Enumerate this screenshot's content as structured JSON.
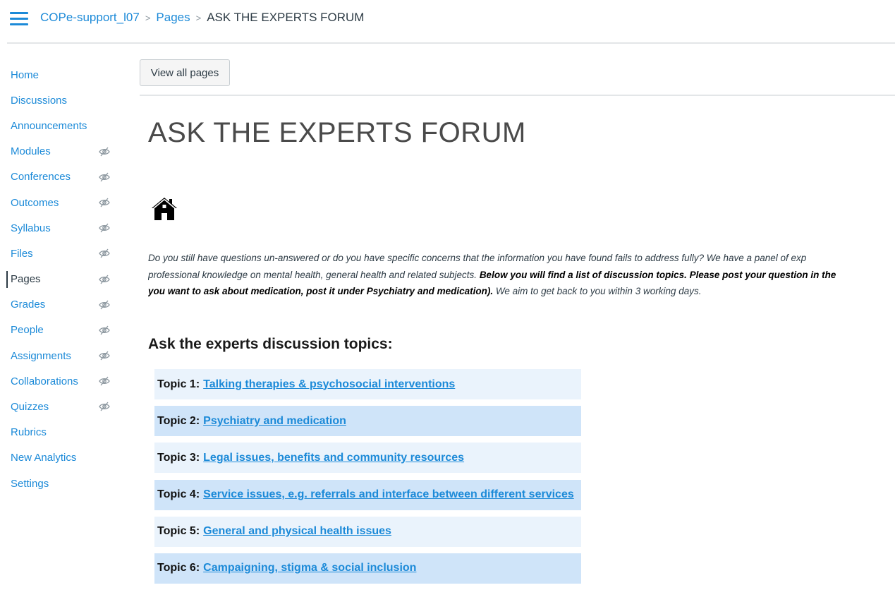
{
  "header": {
    "breadcrumb": {
      "course": "COPe-support_l07",
      "section": "Pages",
      "current": "ASK THE EXPERTS FORUM",
      "separator": ">"
    }
  },
  "sidebar": {
    "items": [
      {
        "label": "Home",
        "hidden_icon": false,
        "active": false
      },
      {
        "label": "Discussions",
        "hidden_icon": false,
        "active": false
      },
      {
        "label": "Announcements",
        "hidden_icon": false,
        "active": false
      },
      {
        "label": "Modules",
        "hidden_icon": true,
        "active": false
      },
      {
        "label": "Conferences",
        "hidden_icon": true,
        "active": false
      },
      {
        "label": "Outcomes",
        "hidden_icon": true,
        "active": false
      },
      {
        "label": "Syllabus",
        "hidden_icon": true,
        "active": false
      },
      {
        "label": "Files",
        "hidden_icon": true,
        "active": false
      },
      {
        "label": "Pages",
        "hidden_icon": true,
        "active": true
      },
      {
        "label": "Grades",
        "hidden_icon": true,
        "active": false
      },
      {
        "label": "People",
        "hidden_icon": true,
        "active": false
      },
      {
        "label": "Assignments",
        "hidden_icon": true,
        "active": false
      },
      {
        "label": "Collaborations",
        "hidden_icon": true,
        "active": false
      },
      {
        "label": "Quizzes",
        "hidden_icon": true,
        "active": false
      },
      {
        "label": "Rubrics",
        "hidden_icon": false,
        "active": false
      },
      {
        "label": "New Analytics",
        "hidden_icon": false,
        "active": false
      },
      {
        "label": "Settings",
        "hidden_icon": false,
        "active": false
      }
    ]
  },
  "main": {
    "view_all_label": "View all pages",
    "title": "ASK THE EXPERTS FORUM",
    "intro": {
      "line1": "Do you still have questions un-answered or do you have specific concerns that the information you have found fails to address fully? We have a panel of exp",
      "line2_plain": "professional knowledge on mental health, general health and related subjects. ",
      "line2_bold": "Below you will find a list of discussion topics. Please post your question in the",
      "line3_bold": "you want to ask about medication, post it under Psychiatry and medication).",
      "line3_plain": " We aim to get back to you within 3 working days."
    },
    "topics_heading": "Ask the experts discussion topics:",
    "topics": [
      {
        "prefix": "Topic 1:",
        "link": "Talking therapies & psychosocial interventions"
      },
      {
        "prefix": "Topic 2:",
        "link": "Psychiatry and medication"
      },
      {
        "prefix": "Topic 3:",
        "link": "Legal issues, benefits and community resources"
      },
      {
        "prefix": "Topic 4:",
        "link": "Service issues, e.g. referrals and interface between different services"
      },
      {
        "prefix": "Topic 5:",
        "link": "General and physical health issues"
      },
      {
        "prefix": "Topic 6:",
        "link": "Campaigning, stigma & social inclusion"
      }
    ]
  },
  "colors": {
    "link": "#1c8ad8",
    "text": "#2d3b45",
    "topic_light_bg": "#eaf3fc",
    "topic_dark_bg": "#cfe4f9"
  },
  "icons": {
    "menu": "hamburger-icon",
    "hidden": "eye-slash-icon",
    "home": "home-icon"
  }
}
